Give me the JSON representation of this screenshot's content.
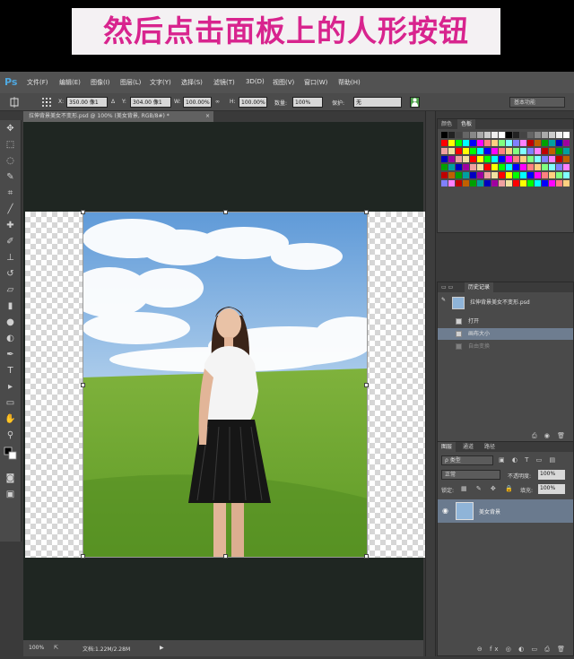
{
  "banner": {
    "caption": "然后点击面板上的人形按钮"
  },
  "app": {
    "logo": "Ps"
  },
  "menu": [
    {
      "label": "文件(F)"
    },
    {
      "label": "编辑(E)"
    },
    {
      "label": "图像(I)"
    },
    {
      "label": "图层(L)"
    },
    {
      "label": "文字(Y)"
    },
    {
      "label": "选择(S)"
    },
    {
      "label": "滤镜(T)"
    },
    {
      "label": "3D(D)"
    },
    {
      "label": "视图(V)"
    },
    {
      "label": "窗口(W)"
    },
    {
      "label": "帮助(H)"
    }
  ],
  "options": {
    "x_label": "X:",
    "x_value": "350.00 像1",
    "y_label": "Y:",
    "y_value": "304.00 像1",
    "w_label": "W:",
    "w_value": "100.00%",
    "h_label": "H:",
    "h_value": "100.00%",
    "density_label": "数量:",
    "density_value": "100%",
    "protect_label": "保护:",
    "protect_value": "无",
    "workspace": "基本功能"
  },
  "document": {
    "tab_title": "拉伸背景美女不变形.psd @ 100% (美女背景, RGB/8#) *",
    "close_glyph": "×"
  },
  "status": {
    "zoom": "100%",
    "doc_info": "文档:1.22M/2.28M"
  },
  "swatches_panel": {
    "tabs": [
      "颜色",
      "色板"
    ],
    "colors": [
      "#ff0000",
      "#ffff00",
      "#00ff00",
      "#00ffff",
      "#0000ff",
      "#ff00ff",
      "#ff8080",
      "#ffd080",
      "#80ff80",
      "#80ffff",
      "#8080ff",
      "#ff80ff",
      "#c00000",
      "#c06000",
      "#00a000",
      "#00a0a0",
      "#0000c0",
      "#a000a0",
      "#f0a0a0",
      "#f0e0a0"
    ]
  },
  "history_panel": {
    "tabs": [
      "历史记录"
    ],
    "snapshot": "拉伸背景美女不变形.psd",
    "items": [
      {
        "label": "打开",
        "state": "normal"
      },
      {
        "label": "画布大小",
        "state": "selected"
      },
      {
        "label": "自由变换",
        "state": "dim"
      }
    ]
  },
  "layers_panel": {
    "tabs": [
      "图层",
      "通道",
      "路径"
    ],
    "filter": "ρ 类型",
    "blend_mode": "正常",
    "opacity_label": "不透明度:",
    "opacity_value": "100%",
    "lock_label": "锁定:",
    "fill_label": "填充:",
    "fill_value": "100%",
    "layers": [
      {
        "name": "美女背景",
        "visible": true
      }
    ]
  }
}
